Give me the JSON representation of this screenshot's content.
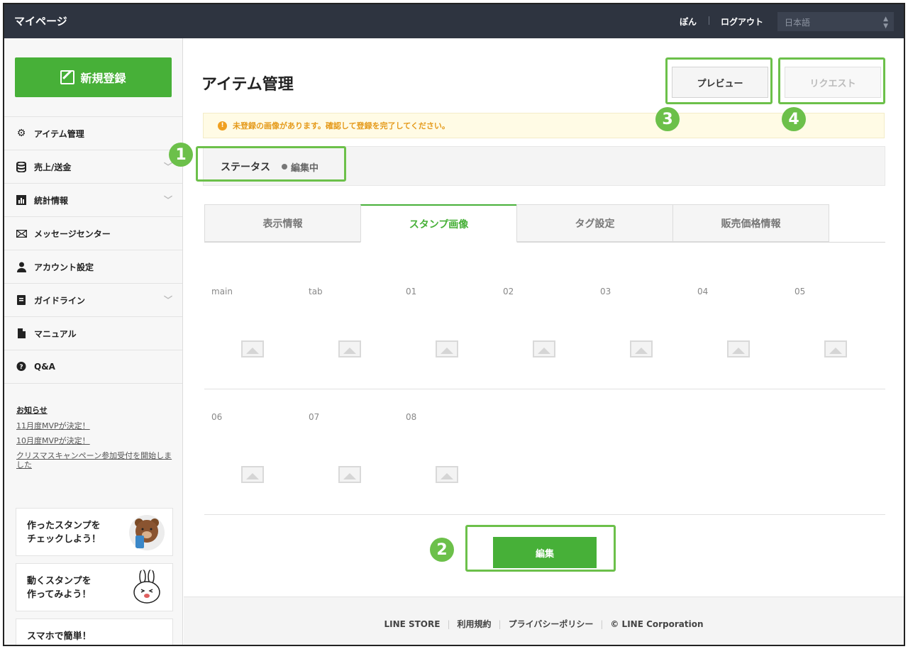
{
  "topbar": {
    "brand": "マイページ",
    "user": "ぽん",
    "logout": "ログアウト",
    "language": "日本語"
  },
  "sidebar": {
    "new_button": "新規登録",
    "items": [
      {
        "label": "アイテム管理",
        "icon": "gear-icon",
        "chevron": false
      },
      {
        "label": "売上/送金",
        "icon": "database-icon",
        "chevron": true
      },
      {
        "label": "統計情報",
        "icon": "bar-chart-icon",
        "chevron": true
      },
      {
        "label": "メッセージセンター",
        "icon": "mail-icon",
        "chevron": false
      },
      {
        "label": "アカウント設定",
        "icon": "user-icon",
        "chevron": false
      },
      {
        "label": "ガイドライン",
        "icon": "document-icon",
        "chevron": true
      },
      {
        "label": "マニュアル",
        "icon": "file-icon",
        "chevron": false
      },
      {
        "label": "Q&A",
        "icon": "question-icon",
        "chevron": false
      }
    ],
    "news_title": "お知らせ",
    "news": [
      "11月度MVPが決定！",
      "10月度MVPが決定！",
      "クリスマスキャンペーン参加受付を開始しました"
    ],
    "promos": [
      "作ったスタンプを\nチェックしよう！",
      "動くスタンプを\n作ってみよう！",
      "スマホで簡単！"
    ]
  },
  "main": {
    "title": "アイテム管理",
    "preview_button": "プレビュー",
    "request_button": "リクエスト",
    "notice": "未登録の画像があります。確認して登録を完了してください。",
    "status_label": "ステータス",
    "status_value": "編集中",
    "tabs": [
      "表示情報",
      "スタンプ画像",
      "タグ設定",
      "販売価格情報"
    ],
    "active_tab": 1,
    "images_row1": [
      "main",
      "tab",
      "01",
      "02",
      "03",
      "04",
      "05"
    ],
    "images_row2": [
      "06",
      "07",
      "08"
    ],
    "edit_button": "編集"
  },
  "footer": {
    "links": [
      "LINE STORE",
      "利用規約",
      "プライバシーポリシー",
      "© LINE Corporation"
    ]
  },
  "callouts": [
    "1",
    "2",
    "3",
    "4"
  ],
  "colors": {
    "accent": "#47b038",
    "callout": "#6cc04a",
    "topbar": "#2e3440",
    "notice_text": "#e59a1a"
  }
}
